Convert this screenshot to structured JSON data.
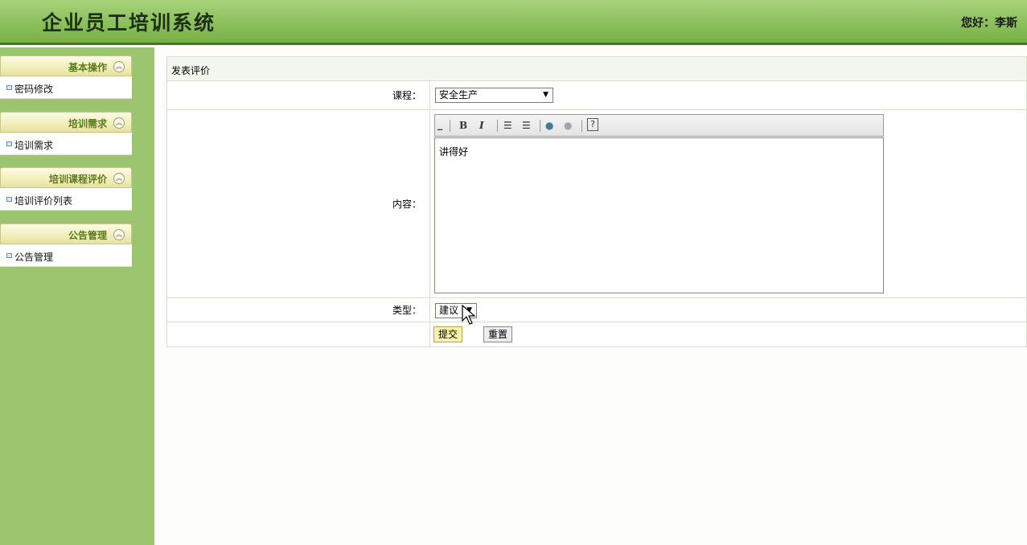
{
  "header": {
    "title": "企业员工培训系统",
    "greeting": "您好：李斯"
  },
  "sidebar": {
    "menus": [
      {
        "label": "基本操作",
        "items": [
          "密码修改"
        ]
      },
      {
        "label": "培训需求",
        "items": [
          "培训需求"
        ]
      },
      {
        "label": "培训课程评价",
        "items": [
          "培训评价列表"
        ]
      },
      {
        "label": "公告管理",
        "items": [
          "公告管理"
        ]
      }
    ]
  },
  "form": {
    "caption": "发表评价",
    "course_label": "课程：",
    "course_value": "安全生产",
    "content_label": "内容：",
    "content_value": "讲得好",
    "type_label": "类型：",
    "type_value": "建议",
    "submit_label": "提交",
    "reset_label": "重置"
  },
  "colors": {
    "header": "#8cc05c",
    "header_border": "#3f7a1c",
    "sidebar": "#9cc56f",
    "menu_label": "#5a7a1f"
  }
}
